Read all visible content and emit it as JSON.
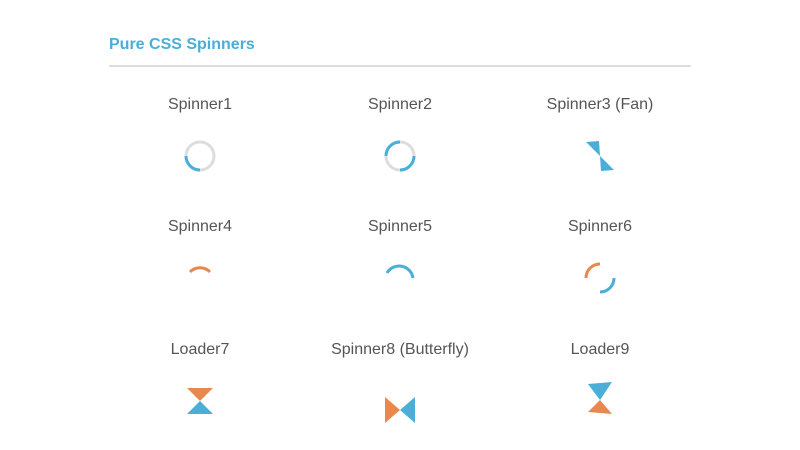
{
  "header": {
    "title": "Pure CSS Spinners"
  },
  "colors": {
    "accent_blue": "#4AAED9",
    "accent_orange": "#E8884F",
    "track_gray": "#DDDDDD",
    "label_gray": "#555555",
    "divider_gray": "#DDDDDD"
  },
  "spinners": [
    {
      "label": "Spinner1"
    },
    {
      "label": "Spinner2"
    },
    {
      "label": "Spinner3 (Fan)"
    },
    {
      "label": "Spinner4"
    },
    {
      "label": "Spinner5"
    },
    {
      "label": "Spinner6"
    },
    {
      "label": "Loader7"
    },
    {
      "label": "Spinner8 (Butterfly)"
    },
    {
      "label": "Loader9"
    }
  ]
}
